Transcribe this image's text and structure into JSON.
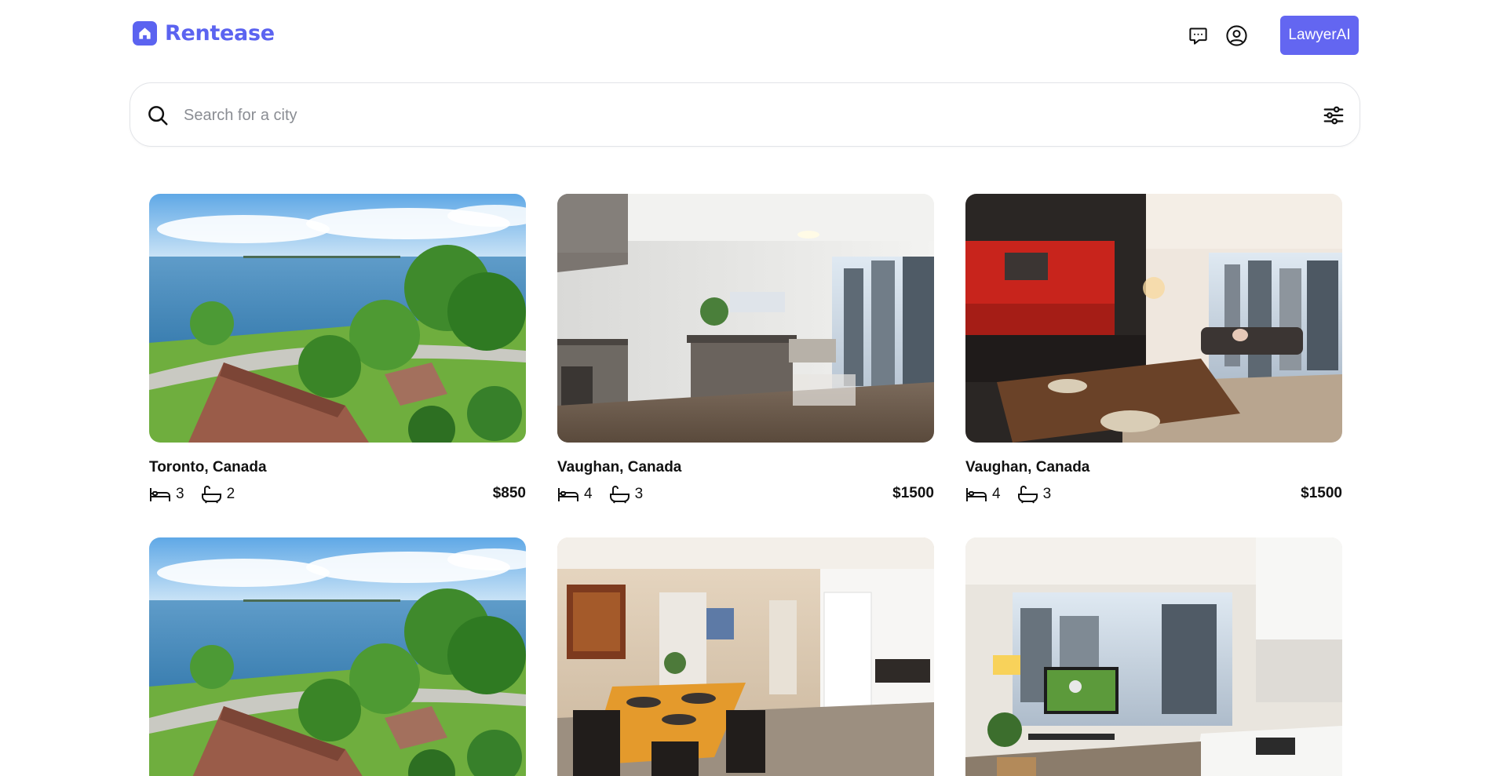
{
  "brand": {
    "name": "Rentease",
    "accent": "#5b63f0"
  },
  "header": {
    "chat_icon": "chat-bubble-icon",
    "profile_icon": "user-circle-icon",
    "cta_label": "LawyerAI",
    "cta_color": "#6366f1"
  },
  "search": {
    "placeholder": "Search for a city",
    "value": "",
    "search_icon": "search-icon",
    "filter_icon": "sliders-icon"
  },
  "listings": [
    {
      "location": "Toronto, Canada",
      "beds": "3",
      "baths": "2",
      "price": "$850",
      "image": "lakeside-aerial"
    },
    {
      "location": "Vaughan, Canada",
      "beds": "4",
      "baths": "3",
      "price": "$1500",
      "image": "modern-kitchen-grey"
    },
    {
      "location": "Vaughan, Canada",
      "beds": "4",
      "baths": "3",
      "price": "$1500",
      "image": "red-kitchen-living"
    },
    {
      "location": "",
      "beds": "",
      "baths": "",
      "price": "",
      "image": "lakeside-aerial"
    },
    {
      "location": "",
      "beds": "",
      "baths": "",
      "price": "",
      "image": "dining-room-posters"
    },
    {
      "location": "",
      "beds": "",
      "baths": "",
      "price": "",
      "image": "condo-tv-kitchen"
    }
  ]
}
